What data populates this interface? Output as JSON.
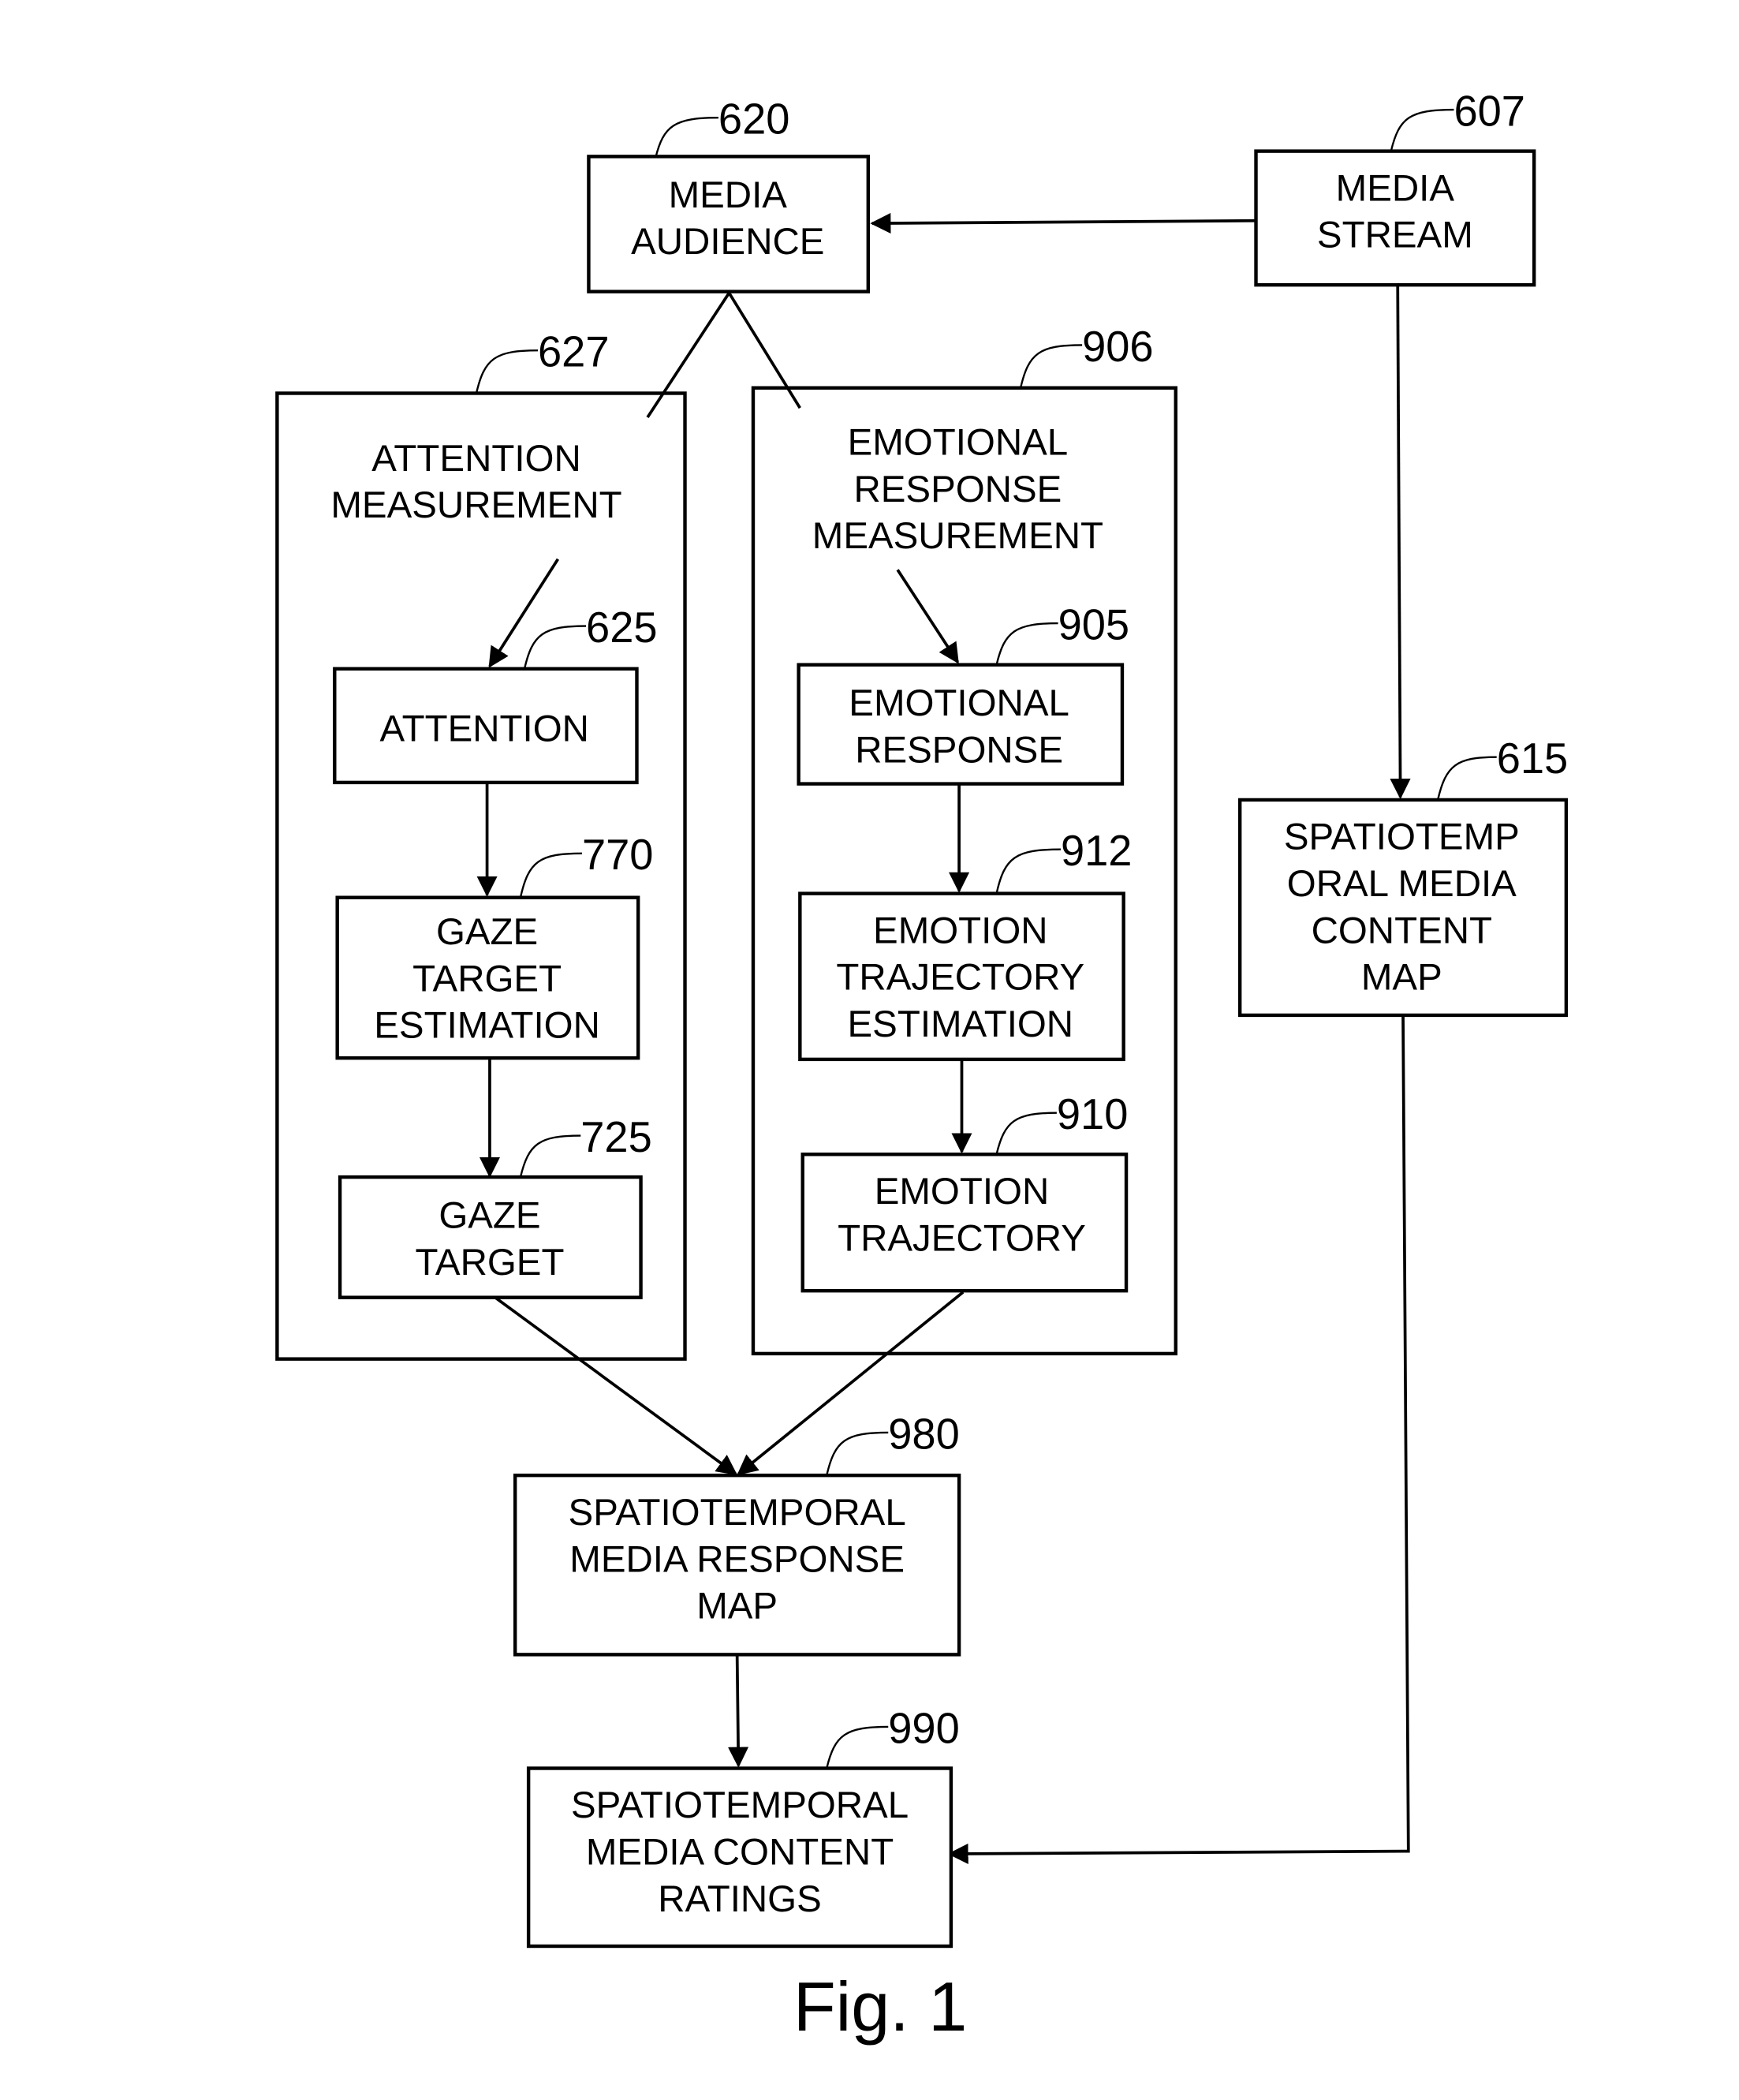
{
  "figure": {
    "caption": "Fig. 1"
  },
  "nodes": {
    "media_audience": {
      "ref": "620",
      "lines": [
        "MEDIA",
        "AUDIENCE"
      ]
    },
    "media_stream": {
      "ref": "607",
      "lines": [
        "MEDIA",
        "STREAM"
      ]
    },
    "attention_measurement": {
      "ref": "627",
      "lines": [
        "ATTENTION",
        "MEASUREMENT"
      ]
    },
    "emotional_response_measurement": {
      "ref": "906",
      "lines": [
        "EMOTIONAL",
        "RESPONSE",
        "MEASUREMENT"
      ]
    },
    "attention": {
      "ref": "625",
      "lines": [
        "ATTENTION"
      ]
    },
    "gaze_target_estimation": {
      "ref": "770",
      "lines": [
        "GAZE",
        "TARGET",
        "ESTIMATION"
      ]
    },
    "gaze_target": {
      "ref": "725",
      "lines": [
        "GAZE",
        "TARGET"
      ]
    },
    "emotional_response": {
      "ref": "905",
      "lines": [
        "EMOTIONAL",
        "RESPONSE"
      ]
    },
    "emotion_trajectory_estimation": {
      "ref": "912",
      "lines": [
        "EMOTION",
        "TRAJECTORY",
        "ESTIMATION"
      ]
    },
    "emotion_trajectory": {
      "ref": "910",
      "lines": [
        "EMOTION",
        "TRAJECTORY"
      ]
    },
    "spatiotemporal_media_content_map": {
      "ref": "615",
      "lines": [
        "SPATIOTEMP",
        "ORAL MEDIA",
        "CONTENT",
        "MAP"
      ]
    },
    "spatiotemporal_media_response_map": {
      "ref": "980",
      "lines": [
        "SPATIOTEMPORAL",
        "MEDIA RESPONSE",
        "MAP"
      ]
    },
    "spatiotemporal_media_content_ratings": {
      "ref": "990",
      "lines": [
        "SPATIOTEMPORAL",
        "MEDIA CONTENT",
        "RATINGS"
      ]
    }
  },
  "edges": [
    {
      "from": "media_stream",
      "to": "media_audience"
    },
    {
      "from": "media_audience",
      "to": "attention_measurement"
    },
    {
      "from": "media_audience",
      "to": "emotional_response_measurement"
    },
    {
      "from": "attention_measurement",
      "to": "attention"
    },
    {
      "from": "attention",
      "to": "gaze_target_estimation"
    },
    {
      "from": "gaze_target_estimation",
      "to": "gaze_target"
    },
    {
      "from": "emotional_response_measurement",
      "to": "emotional_response"
    },
    {
      "from": "emotional_response",
      "to": "emotion_trajectory_estimation"
    },
    {
      "from": "emotion_trajectory_estimation",
      "to": "emotion_trajectory"
    },
    {
      "from": "media_stream",
      "to": "spatiotemporal_media_content_map"
    },
    {
      "from": "gaze_target",
      "to": "spatiotemporal_media_response_map"
    },
    {
      "from": "emotion_trajectory",
      "to": "spatiotemporal_media_response_map"
    },
    {
      "from": "spatiotemporal_media_response_map",
      "to": "spatiotemporal_media_content_ratings"
    },
    {
      "from": "spatiotemporal_media_content_map",
      "to": "spatiotemporal_media_content_ratings"
    }
  ]
}
